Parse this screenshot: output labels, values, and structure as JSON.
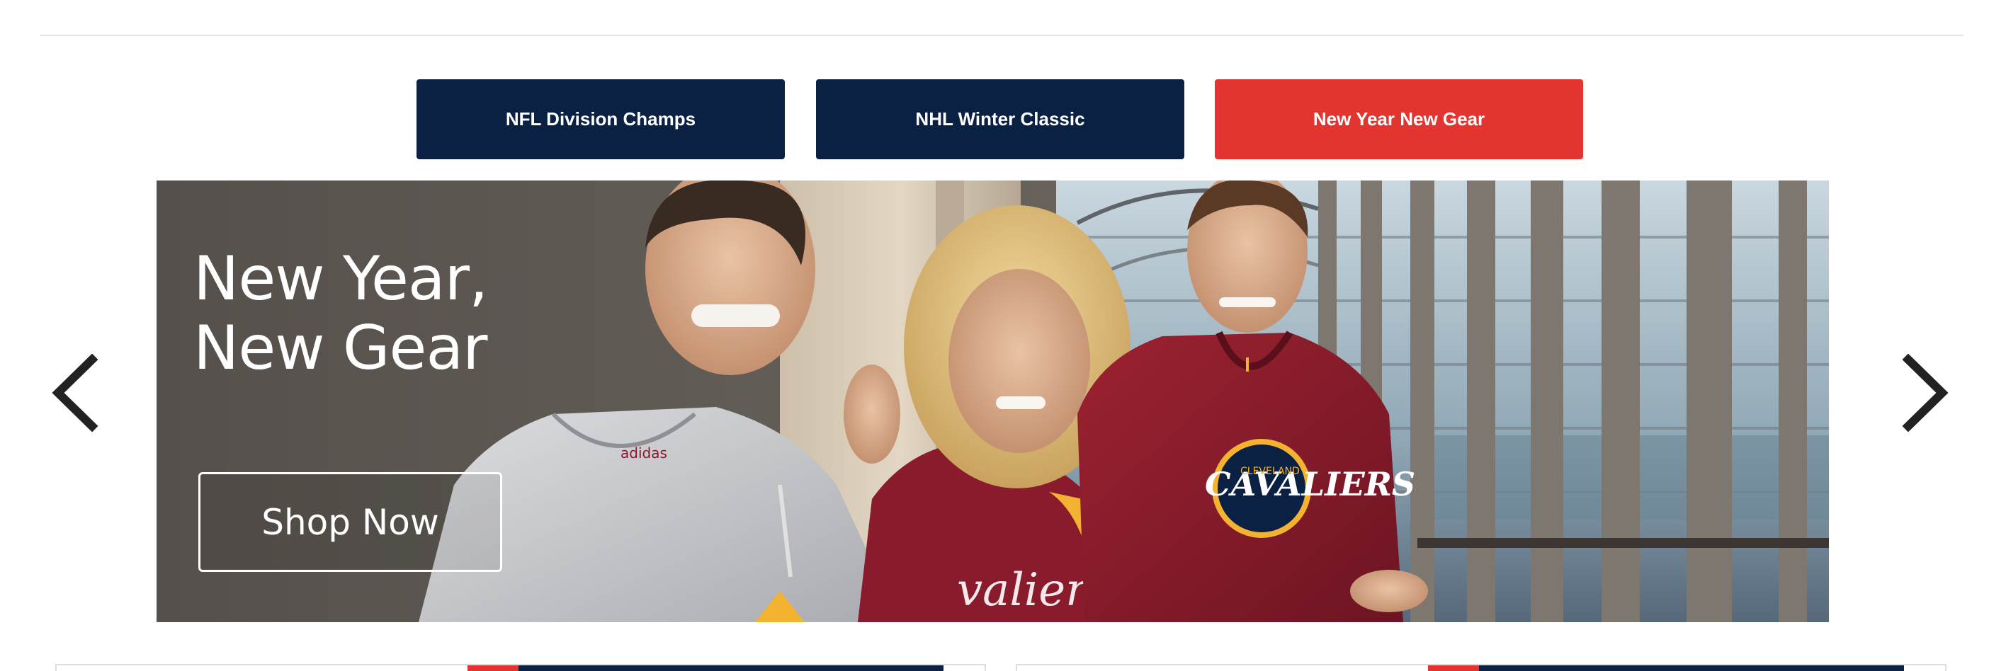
{
  "nav_tabs": [
    {
      "label": "NFL Division Champs",
      "color": "#0b2144"
    },
    {
      "label": "NHL Winter Classic",
      "color": "#0b2144"
    },
    {
      "label": "New Year New Gear",
      "color": "#e2352f",
      "active": true
    }
  ],
  "hero": {
    "headline_line1": "New Year,",
    "headline_line2": "New Gear",
    "cta_label": "Shop Now",
    "image": "photo of three models wearing Cleveland Cavaliers hoodies",
    "visible_logo_text": [
      "CLEVELAND",
      "CAVALIERS",
      "adidas"
    ]
  },
  "carousel": {
    "prev_icon": "chevron-left-icon",
    "next_icon": "chevron-right-icon"
  },
  "colors": {
    "navy": "#0b2144",
    "red": "#e2352f",
    "wine": "#8a1b2c",
    "gold": "#f3b22f"
  }
}
